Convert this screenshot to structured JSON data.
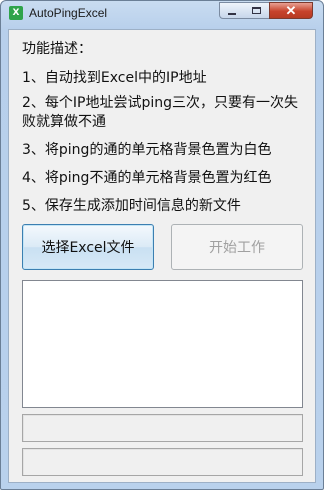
{
  "window": {
    "title": "AutoPingExcel",
    "icon_glyph": "X",
    "close_glyph": "✕"
  },
  "description": {
    "heading": "功能描述：",
    "items": [
      "1、自动找到Excel中的IP地址",
      "2、每个IP地址尝试ping三次，只要有一次失败就算做不通",
      "3、将ping的通的单元格背景色置为白色",
      "4、将ping不通的单元格背景色置为红色",
      "5、保存生成添加时间信息的新文件"
    ]
  },
  "buttons": {
    "select_label": "选择Excel文件",
    "start_label": "开始工作"
  },
  "log": {
    "text": ""
  },
  "status": {
    "line1": "",
    "line2": ""
  }
}
